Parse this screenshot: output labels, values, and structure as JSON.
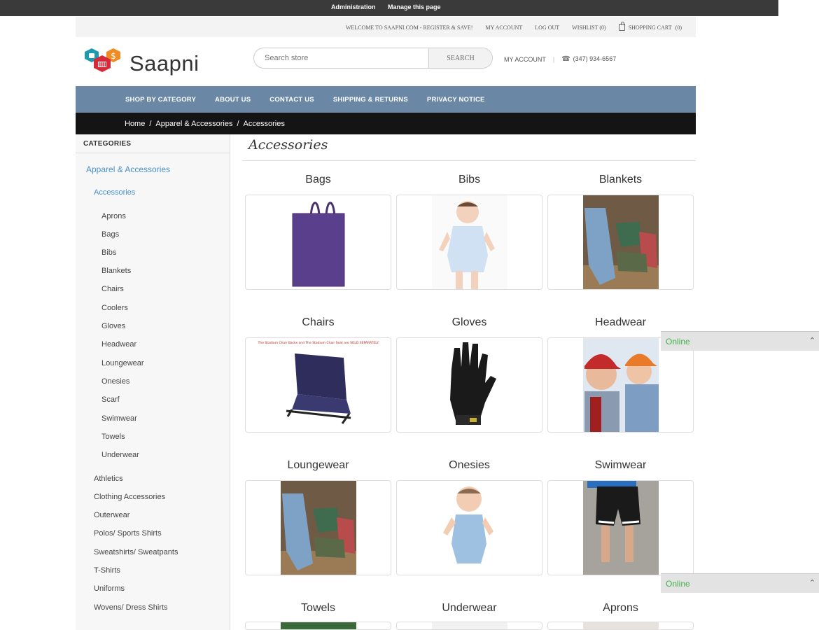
{
  "admin": {
    "administration": "Administration",
    "manage": "Manage this page"
  },
  "topbar": {
    "welcome": "WELCOME TO SAAPNI.COM - REGISTER & SAVE!",
    "my_account": "MY ACCOUNT",
    "logout": "LOG OUT",
    "wishlist": "WISHLIST (0)",
    "cart": "SHOPPING CART",
    "cart_count": "(0)"
  },
  "header": {
    "logo_text": "Saapni",
    "search_placeholder": "Search store",
    "search_button": "SEARCH",
    "my_account": "MY ACCOUNT",
    "phone": "(347) 934-6567"
  },
  "nav": [
    "SHOP BY CATEGORY",
    "ABOUT US",
    "CONTACT US",
    "SHIPPING & RETURNS",
    "PRIVACY NOTICE"
  ],
  "breadcrumb": [
    "Home",
    "Apparel & Accessories",
    "Accessories"
  ],
  "sidebar": {
    "title": "CATEGORIES",
    "top": "Apparel & Accessories",
    "active": "Accessories",
    "sub": [
      "Aprons",
      "Bags",
      "Bibs",
      "Blankets",
      "Chairs",
      "Coolers",
      "Gloves",
      "Headwear",
      "Loungewear",
      "Onesies",
      "Scarf",
      "Swimwear",
      "Towels",
      "Underwear"
    ],
    "siblings": [
      "Athletics",
      "Clothing Accessories",
      "Outerwear",
      "Polos/ Sports Shirts",
      "Sweatshirts/ Sweatpants",
      "T-Shirts",
      "Uniforms",
      "Wovens/ Dress Shirts"
    ]
  },
  "page_title": "Accessories",
  "categories": [
    "Bags",
    "Bibs",
    "Blankets",
    "Chairs",
    "Gloves",
    "Headwear",
    "Loungewear",
    "Onesies",
    "Swimwear",
    "Towels",
    "Underwear",
    "Aprons"
  ],
  "chair_caption": "The Stadium Chair Backs and The Stadium Chair Seat are SOLD SEPARATELY.",
  "online": {
    "label": "Online"
  },
  "colors": {
    "nav": "#6a88a6",
    "link": "#4a90c8",
    "online": "#44b14a"
  }
}
